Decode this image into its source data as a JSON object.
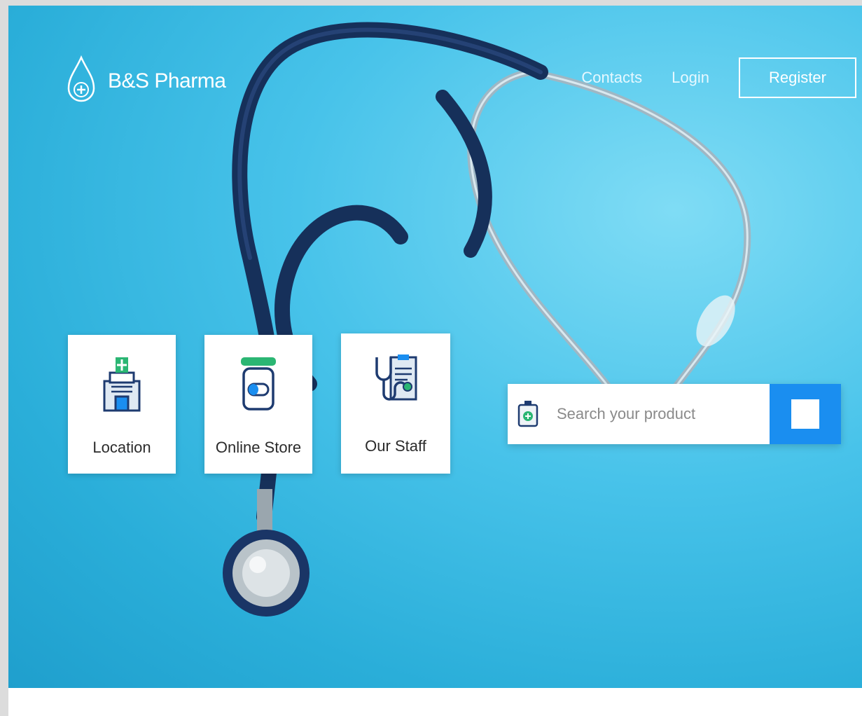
{
  "brand": {
    "name": "B&S Pharma",
    "logo_icon": "drop-plus-icon"
  },
  "nav": {
    "contacts": "Contacts",
    "login": "Login",
    "register": "Register"
  },
  "cards": [
    {
      "label": "Location",
      "icon": "hospital-building-icon"
    },
    {
      "label": "Online Store",
      "icon": "pill-jar-icon"
    },
    {
      "label": "Our Staff",
      "icon": "stethoscope-clipboard-icon"
    }
  ],
  "search": {
    "placeholder": "Search your product",
    "icon": "medicine-bottle-icon",
    "button_icon": "search-square-icon"
  },
  "colors": {
    "hero_bg": "#2aaed9",
    "accent_blue": "#1a8ef0",
    "icon_navy": "#1e3b70",
    "icon_green": "#2bb673"
  }
}
